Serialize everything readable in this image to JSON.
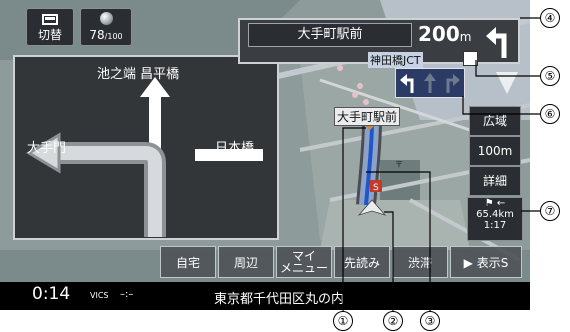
{
  "top_buttons": {
    "switch_label": "切替",
    "zoom_value": "78",
    "zoom_denominator": "/100"
  },
  "junction": {
    "top_label": "池之端 昌平橋",
    "left_label": "大手門",
    "right_label": "日本橋"
  },
  "guidance": {
    "intersection_name": "大手町駅前",
    "distance": "200",
    "distance_unit": "m",
    "turn_direction": "left"
  },
  "map": {
    "jct_label": "神田橋JCT",
    "station_label": "大手町駅前",
    "lanes": [
      "left",
      "straight",
      "right"
    ],
    "highlighted_lane": "left"
  },
  "side_buttons": {
    "wide": "広域",
    "scale": "100m",
    "detail": "詳細"
  },
  "destination": {
    "distance": "65.4km",
    "time": "1:17"
  },
  "menu": {
    "items": [
      "自宅",
      "周辺",
      "マイ",
      "メニュー",
      "先読み",
      "渋滞",
      "▶ 表示S"
    ]
  },
  "status": {
    "clock": "0:14",
    "vics": "VICS",
    "vics_value": "–:–",
    "address": "東京都千代田区丸の内"
  },
  "callouts": [
    "①",
    "②",
    "③",
    "④",
    "⑤",
    "⑥",
    "⑦"
  ]
}
